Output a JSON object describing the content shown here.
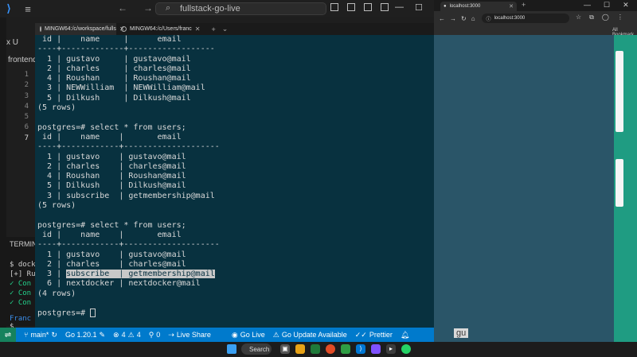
{
  "vscode": {
    "title_search": "fullstack-go-live",
    "sidebar_label": "x U",
    "explorer_label": "frontend",
    "line_numbers": [
      "1",
      "2",
      "3",
      "4",
      "5",
      "6",
      "7"
    ],
    "terminal_panel": {
      "title": "TERMINA",
      "lines": [
        "$ dock",
        "[+] Ru",
        "✓ Con",
        "✓ Con",
        "✓ Con",
        "",
        "Franc"
      ],
      "prompt": "$"
    },
    "status": {
      "branch": "main*",
      "go_version": "Go 1.20.1",
      "errors": "4",
      "warnings": "4",
      "ports": "0",
      "live_share": "Live Share",
      "go_live": "Go Live",
      "go_update": "Go Update Available",
      "prettier": "Prettier"
    }
  },
  "bash": {
    "tabs": [
      {
        "label": "MINGW64:/c/workspace/fulls"
      },
      {
        "label": "MINGW64:/c/Users/franc"
      }
    ],
    "lines": [
      " id |    name     |      email",
      "----+-------------+------------------",
      "  1 | gustavo     | gustavo@mail",
      "  2 | charles     | charles@mail",
      "  4 | Roushan     | Roushan@mail",
      "  3 | NEWWilliam  | NEWWilliam@mail",
      "  5 | Dilkush     | Dilkush@mail",
      "(5 rows)",
      "",
      "postgres=# select * from users;",
      " id |    name    |       email",
      "----+------------+--------------------",
      "  1 | gustavo    | gustavo@mail",
      "  2 | charles    | charles@mail",
      "  4 | Roushan    | Roushan@mail",
      "  5 | Dilkush    | Dilkush@mail",
      "  3 | subscribe  | getmembership@mail",
      "(5 rows)",
      "",
      "postgres=# select * from users;",
      " id |    name    |       email",
      "----+------------+--------------------",
      "  1 | gustavo    | gustavo@mail",
      "  2 | charles    | charles@mail",
      "",
      "  6 | nextdocker | nextdocker@mail",
      "(4 rows)",
      "",
      "postgres=#"
    ],
    "highlight_line": {
      "prefix": "  3 | ",
      "selected": "subscribe  | getmembership@mail"
    }
  },
  "browser": {
    "tab_title": "localhost:3000",
    "url": "localhost:3000",
    "bookmarks": "All Bookmark",
    "page_fragment": "gu"
  },
  "taskbar": {
    "search": "Search"
  },
  "colors": {
    "terminal_bg": "#08313f",
    "statusbar": "#007acc",
    "accent_green": "#1f9c82"
  }
}
